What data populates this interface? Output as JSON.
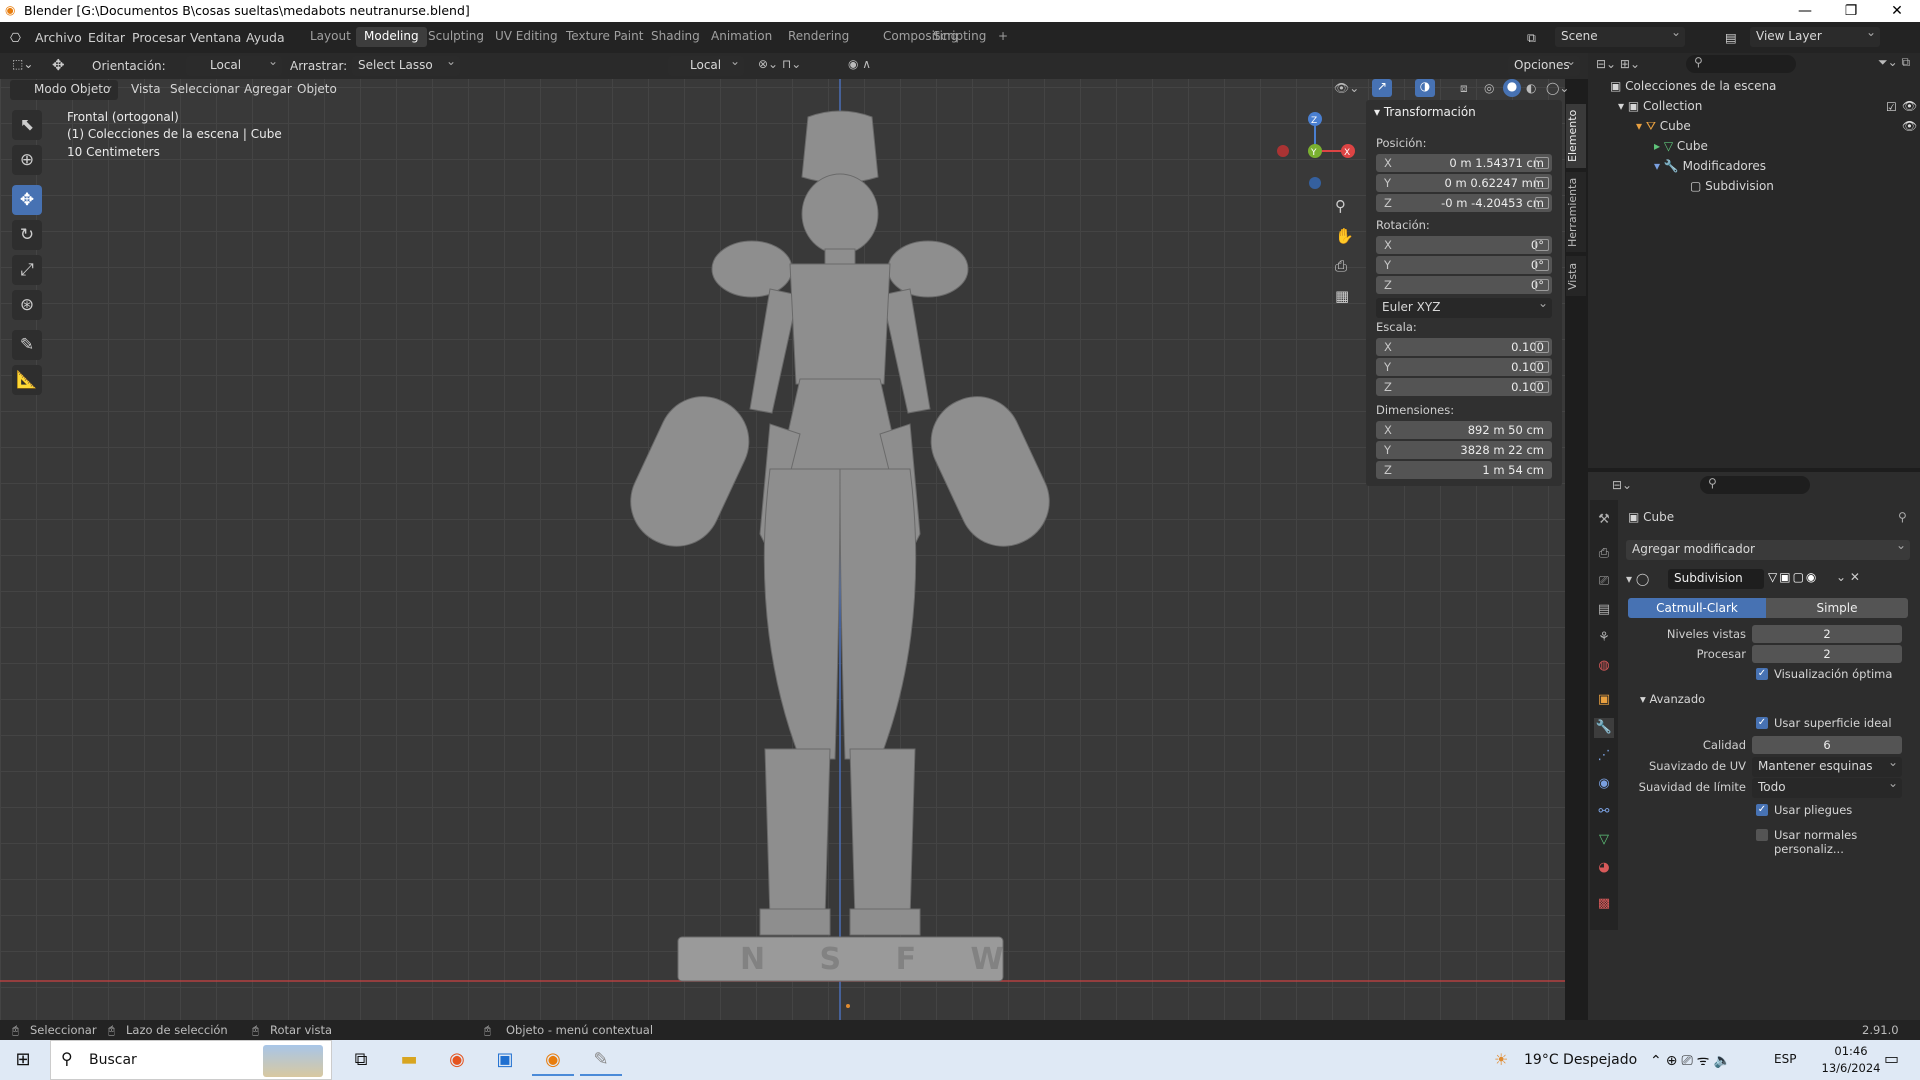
{
  "window": {
    "title": "Blender [G:\\Documentos B\\cosas sueltas\\medabots neutranurse.blend]",
    "controls": [
      "—",
      "❐",
      "✕"
    ]
  },
  "menu": [
    "Archivo",
    "Editar",
    "Procesar",
    "Ventana",
    "Ayuda"
  ],
  "workspaces": [
    "Layout",
    "Modeling",
    "Sculpting",
    "UV Editing",
    "Texture Paint",
    "Shading",
    "Animation",
    "Rendering",
    "Compositing",
    "Scripting",
    "+"
  ],
  "scene": "Scene",
  "view_layer": "View Layer",
  "header": {
    "orientation_label": "Orientación:",
    "orientation": "Local",
    "drag_label": "Arrastrar:",
    "drag": "Select Lasso",
    "pivot": "Local",
    "options": "Opciones"
  },
  "header2": {
    "mode": "Modo Objeto",
    "items": [
      "Vista",
      "Seleccionar",
      "Agregar",
      "Objeto"
    ]
  },
  "viewport_info": {
    "view": "Frontal (ortogonal)",
    "collection": "(1) Colecciones de la escena | Cube",
    "scale": "10 Centimeters",
    "base_text": "N S F W"
  },
  "gizmo": {
    "x": "X",
    "y": "Y",
    "z": "Z"
  },
  "npanel": {
    "section": "Transformación",
    "pos_label": "Posición:",
    "pos": [
      [
        "X",
        "0 m 1.54371 cm"
      ],
      [
        "Y",
        "0 m 0.62247 mm"
      ],
      [
        "Z",
        "-0 m -4.20453 cm"
      ]
    ],
    "rot_label": "Rotación:",
    "rot": [
      [
        "X",
        "0°"
      ],
      [
        "Y",
        "0°"
      ],
      [
        "Z",
        "0°"
      ]
    ],
    "rot_mode": "Euler XYZ",
    "scale_label": "Escala:",
    "scale": [
      [
        "X",
        "0.100"
      ],
      [
        "Y",
        "0.100"
      ],
      [
        "Z",
        "0.100"
      ]
    ],
    "dim_label": "Dimensiones:",
    "dim": [
      [
        "X",
        "892 m 50 cm"
      ],
      [
        "Y",
        "3828 m 22 cm"
      ],
      [
        "Z",
        "1 m 54 cm"
      ]
    ],
    "tabs": [
      "Elemento",
      "Herramienta",
      "Vista"
    ]
  },
  "outliner": {
    "root": "Colecciones de la escena",
    "collection": "Collection",
    "object": "Cube",
    "mesh": "Cube",
    "modifiers": "Modificadores",
    "modifier": "Subdivision"
  },
  "properties": {
    "object": "Cube",
    "add_modifier": "Agregar modificador",
    "modifier_name": "Subdivision",
    "algo": [
      "Catmull-Clark",
      "Simple"
    ],
    "levels_label": "Niveles vistas",
    "levels": "2",
    "render_label": "Procesar",
    "render": "2",
    "optimal": "Visualización óptima",
    "advanced": "Avanzado",
    "limit_surface": "Usar superficie ideal",
    "quality_label": "Calidad",
    "quality": "6",
    "uv_label": "Suavizado de UV",
    "uv": "Mantener esquinas",
    "boundary_label": "Suavidad de límite",
    "boundary": "Todo",
    "creases": "Usar pliegues",
    "custom_normals": "Usar normales personaliz..."
  },
  "status": {
    "select": "Seleccionar",
    "lasso": "Lazo de selección",
    "rotate": "Rotar vista",
    "context": "Objeto - menú contextual",
    "version": "2.91.0"
  },
  "taskbar": {
    "search": "Buscar",
    "weather": "19°C  Despejado",
    "lang": "ESP",
    "time": "01:46",
    "date": "13/6/2024"
  }
}
